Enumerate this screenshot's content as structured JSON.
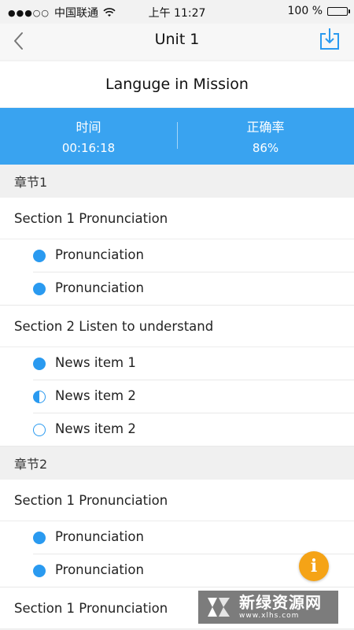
{
  "status_bar": {
    "carrier": "中国联通",
    "time": "上午 11:27",
    "battery": "100 %",
    "battery_level": 1.0
  },
  "nav": {
    "title": "Unit 1",
    "back_icon": "chevron-left-icon",
    "download_icon": "download-icon"
  },
  "mission_title": "Languge in Mission",
  "stats": {
    "time_label": "时间",
    "time_value": "00:16:18",
    "accuracy_label": "正确率",
    "accuracy_value": "86%"
  },
  "colors": {
    "accent": "#39a3f0",
    "dot": "#2a9af0",
    "fab": "#f5a316"
  },
  "chapters": [
    {
      "title": "章节1",
      "sections": [
        {
          "title": "Section 1 Pronunciation",
          "items": [
            {
              "label": "Pronunciation",
              "status": "full"
            },
            {
              "label": "Pronunciation",
              "status": "full"
            }
          ]
        },
        {
          "title": "Section 2 Listen to understand",
          "items": [
            {
              "label": "News item 1",
              "status": "full"
            },
            {
              "label": "News item 2",
              "status": "half"
            },
            {
              "label": "News item 2",
              "status": "empty"
            }
          ]
        }
      ]
    },
    {
      "title": "章节2",
      "sections": [
        {
          "title": "Section 1 Pronunciation",
          "items": [
            {
              "label": "Pronunciation",
              "status": "full"
            },
            {
              "label": "Pronunciation",
              "status": "full"
            }
          ]
        },
        {
          "title": "Section 1 Pronunciation",
          "items": []
        }
      ]
    }
  ],
  "fab_icon": "info-icon",
  "fab_text": "i",
  "watermark": {
    "text": "新绿资源网",
    "url": "www.xlhs.com"
  }
}
